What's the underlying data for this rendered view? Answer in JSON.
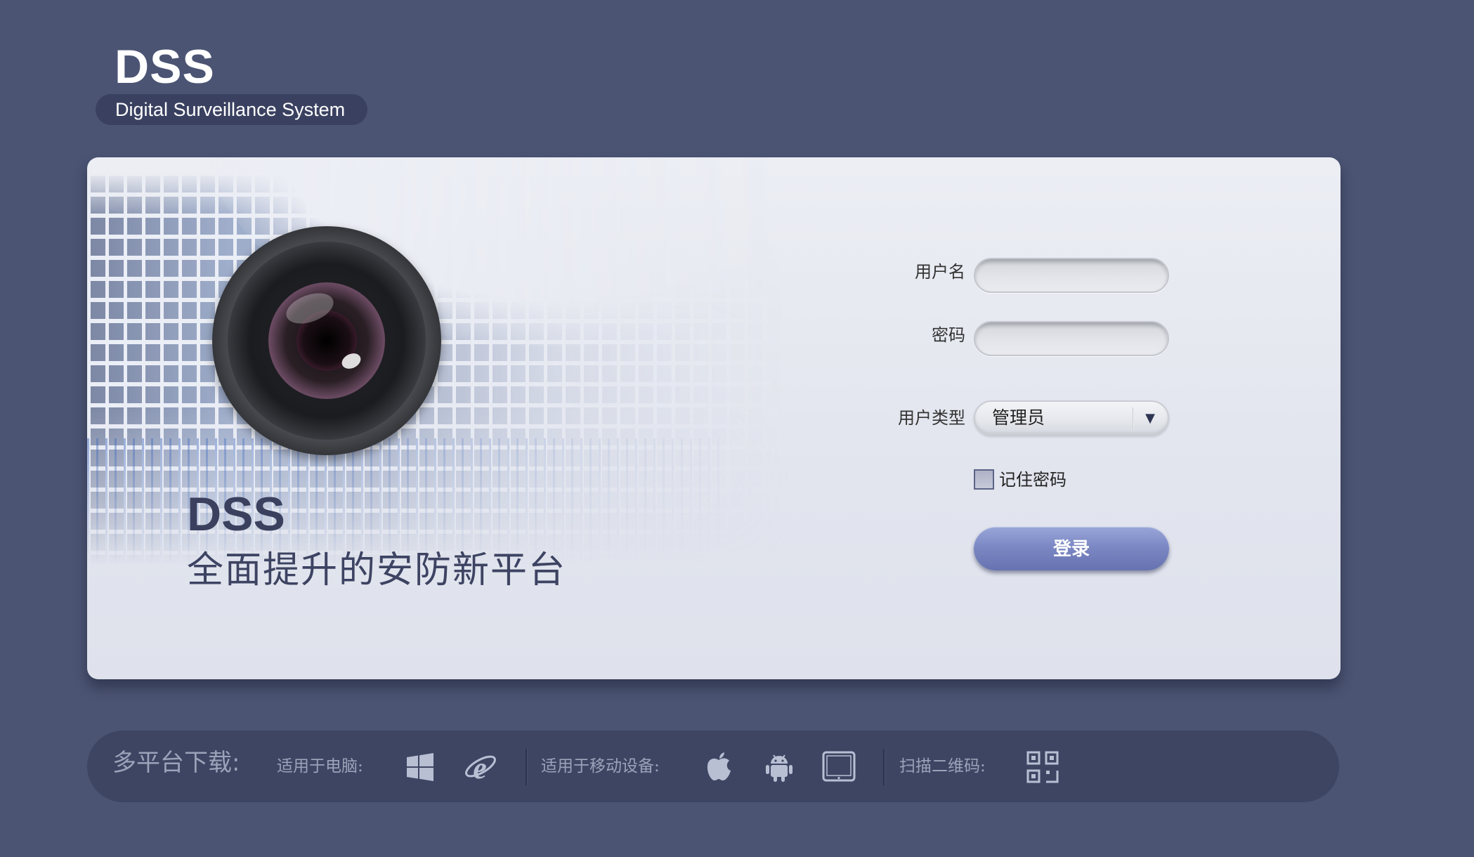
{
  "logo": {
    "title": "DSS",
    "subtitle": "Digital Surveillance System"
  },
  "banner": {
    "title": "DSS",
    "subtitle": "全面提升的安防新平台"
  },
  "login": {
    "username_label": "用户名",
    "username_value": "",
    "password_label": "密码",
    "password_value": "",
    "user_type_label": "用户类型",
    "user_type_value": "管理员",
    "remember_label": "记住密码",
    "remember_checked": false,
    "login_button": "登录"
  },
  "download": {
    "title": "多平台下载:",
    "pc_label": "适用于电脑:",
    "pc_icons": [
      "windows-icon",
      "internet-explorer-icon"
    ],
    "mobile_label": "适用于移动设备:",
    "mobile_icons": [
      "apple-icon",
      "android-icon",
      "tablet-icon"
    ],
    "qr_label": "扫描二维码:",
    "qr_icon": "qr-code-icon"
  },
  "colors": {
    "background": "#4b5473",
    "panel": "#e4e7ef",
    "accent_button": "#7c88c4",
    "download_bar": "#3d4563",
    "muted_text": "#9ca2b8"
  }
}
